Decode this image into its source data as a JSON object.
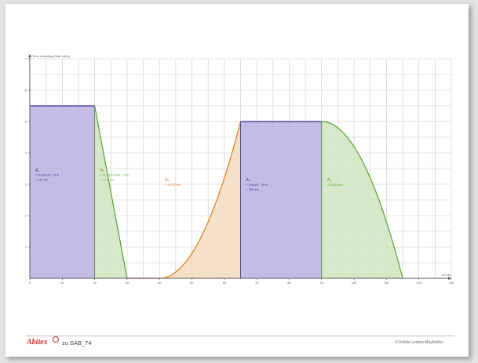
{
  "footer": {
    "logo_text": "Abitex",
    "reference": "zu SAB_74",
    "copyright": "© Rohde Lernen Mayfeld/er"
  },
  "chart_data": {
    "type": "area",
    "ylabel": "Time-Indicating Rate ν(km)",
    "xlabel": "ΔT(%)",
    "xlim": [
      0,
      130
    ],
    "ylim": [
      0,
      7
    ],
    "x_ticks": [
      0,
      10,
      20,
      30,
      40,
      50,
      60,
      70,
      80,
      90,
      100,
      110,
      120,
      130
    ],
    "y_ticks": [
      1,
      2,
      3,
      4,
      5,
      6,
      7
    ],
    "grid": true,
    "segments": [
      {
        "name": "A₁",
        "shape": "rectangle",
        "fill": "#b9b2e0",
        "stroke": "#3a2f8a",
        "x": [
          0,
          20
        ],
        "y": [
          5.5,
          5.5
        ],
        "label_lines": [
          "A₁",
          "= 5,5 km/h · 20 h",
          "= 110 km"
        ]
      },
      {
        "name": "A₂",
        "shape": "linear",
        "fill": "#cfe5c2",
        "stroke": "#5aa02c",
        "x": [
          20,
          30
        ],
        "y": [
          5.5,
          0
        ],
        "label_lines": [
          "A₂",
          "= ½ · 5,5 km/h · 10 h",
          "= 27,5 km"
        ]
      },
      {
        "name": "zero",
        "shape": "constant",
        "fill": "none",
        "stroke": "#cc0000",
        "x": [
          30,
          40
        ],
        "y": [
          0,
          0
        ],
        "label_lines": []
      },
      {
        "name": "A₃",
        "shape": "quadratic",
        "fill": "#f3dcbf",
        "stroke": "#e07b1a",
        "x": [
          40,
          65
        ],
        "y": [
          0,
          5
        ],
        "label_lines": [
          "A₃",
          "= 41,67 km"
        ]
      },
      {
        "name": "A₄",
        "shape": "rectangle",
        "fill": "#b9b2e0",
        "stroke": "#3a2f8a",
        "x": [
          65,
          90
        ],
        "y": [
          5,
          5
        ],
        "label_lines": [
          "A₄",
          "= 5 km/h · 25 h",
          "= 125 km"
        ]
      },
      {
        "name": "A₅",
        "shape": "concave",
        "fill": "#cfe5c2",
        "stroke": "#5aa02c",
        "x": [
          90,
          115
        ],
        "y": [
          5,
          0
        ],
        "label_lines": [
          "A₅",
          "= 83,33 km"
        ]
      }
    ]
  }
}
